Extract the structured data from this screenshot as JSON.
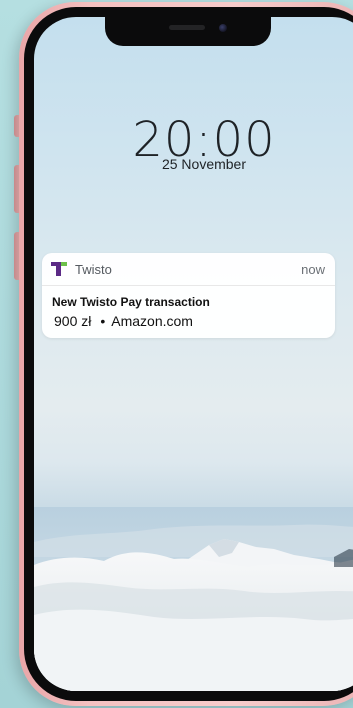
{
  "lock_screen": {
    "time": "20:00",
    "date": "25 November"
  },
  "notification": {
    "app_name": "Twisto",
    "time": "now",
    "title": "New Twisto Pay transaction",
    "amount": "900 zł",
    "separator": "•",
    "merchant": "Amazon.com",
    "icon": "twisto-logo-icon",
    "icon_colors": {
      "purple": "#5b2a86",
      "green": "#6cc04a"
    }
  },
  "colors": {
    "background": "#a9d6d9",
    "frame": "#f4c1c1",
    "bezel": "#0b0b0c"
  }
}
